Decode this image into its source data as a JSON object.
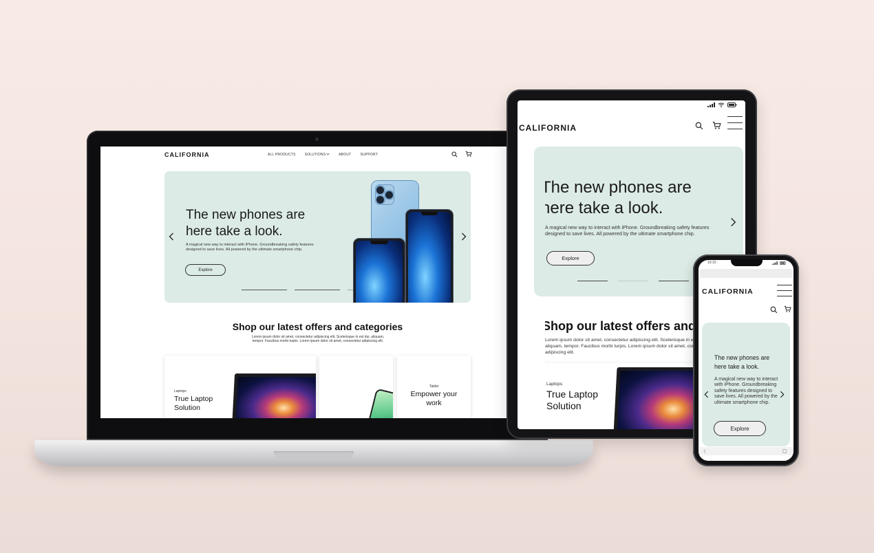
{
  "brand": {
    "logo_text": "CALIFORNIA"
  },
  "laptop": {
    "nav": {
      "items": [
        "ALL PRODUCTS",
        "SOLUTIONS",
        "ABOUT",
        "SUPPORT"
      ]
    },
    "hero": {
      "title": "The new phones are here take a look.",
      "description": "A magical new way to interact with iPhone. Groundbreaking safety features designed to save lives. All powered by the ultimate smartphone chip.",
      "button": "Explore"
    },
    "section": {
      "title": "Shop our latest offers and categories",
      "description": "Lorem ipsum dolor sit amet, consectetur adipiscing elit. Scelerisque in est dui, aliquam, tempor. Faucibus morbi turpis. Lorem ipsum dolor sit amet, consectetur adipiscing elit."
    },
    "cards": [
      {
        "eyebrow": "Laptops",
        "title": "True Laptop Solution"
      },
      {
        "eyebrow": "",
        "title": ""
      },
      {
        "eyebrow": "Tablet",
        "title": "Empower your work"
      }
    ]
  },
  "tablet": {
    "hero": {
      "title": "The new phones are here take a look.",
      "description": "A magical new way to interact with iPhone. Groundbreaking safety features designed to save lives. All powered by the ultimate smartphone chip.",
      "button": "Explore"
    },
    "section": {
      "title": "Shop our latest offers and categories",
      "description": "Lorem ipsum dolor sit amet, consectetur adipiscing elit. Scelerisque in est dui, aliquam, tempor. Faucibus morbi turpis. Lorem ipsum dolor sit amet, consectetur adipiscing elit."
    },
    "card": {
      "eyebrow": "Laptops",
      "title": "True Laptop Solution"
    }
  },
  "phone": {
    "status_time": "10:10",
    "hero": {
      "title": "The new phones are here take a look.",
      "description": "A magical new way to interact with iPhone. Groundbreaking safety features designed to save lives. All powered by the ultimate smartphone chip.",
      "button": "Explore"
    }
  },
  "colors": {
    "background": "#f6e9e4",
    "hero_mint": "#dcebe6",
    "text_dark": "#1a1a1a",
    "screen_bg": "#ffffff"
  },
  "icons": {
    "search": "search-icon",
    "cart": "cart-icon",
    "menu": "hamburger-menu-icon",
    "prev": "chevron-left-icon",
    "next": "chevron-right-icon",
    "dropdown": "chevron-down-icon"
  }
}
